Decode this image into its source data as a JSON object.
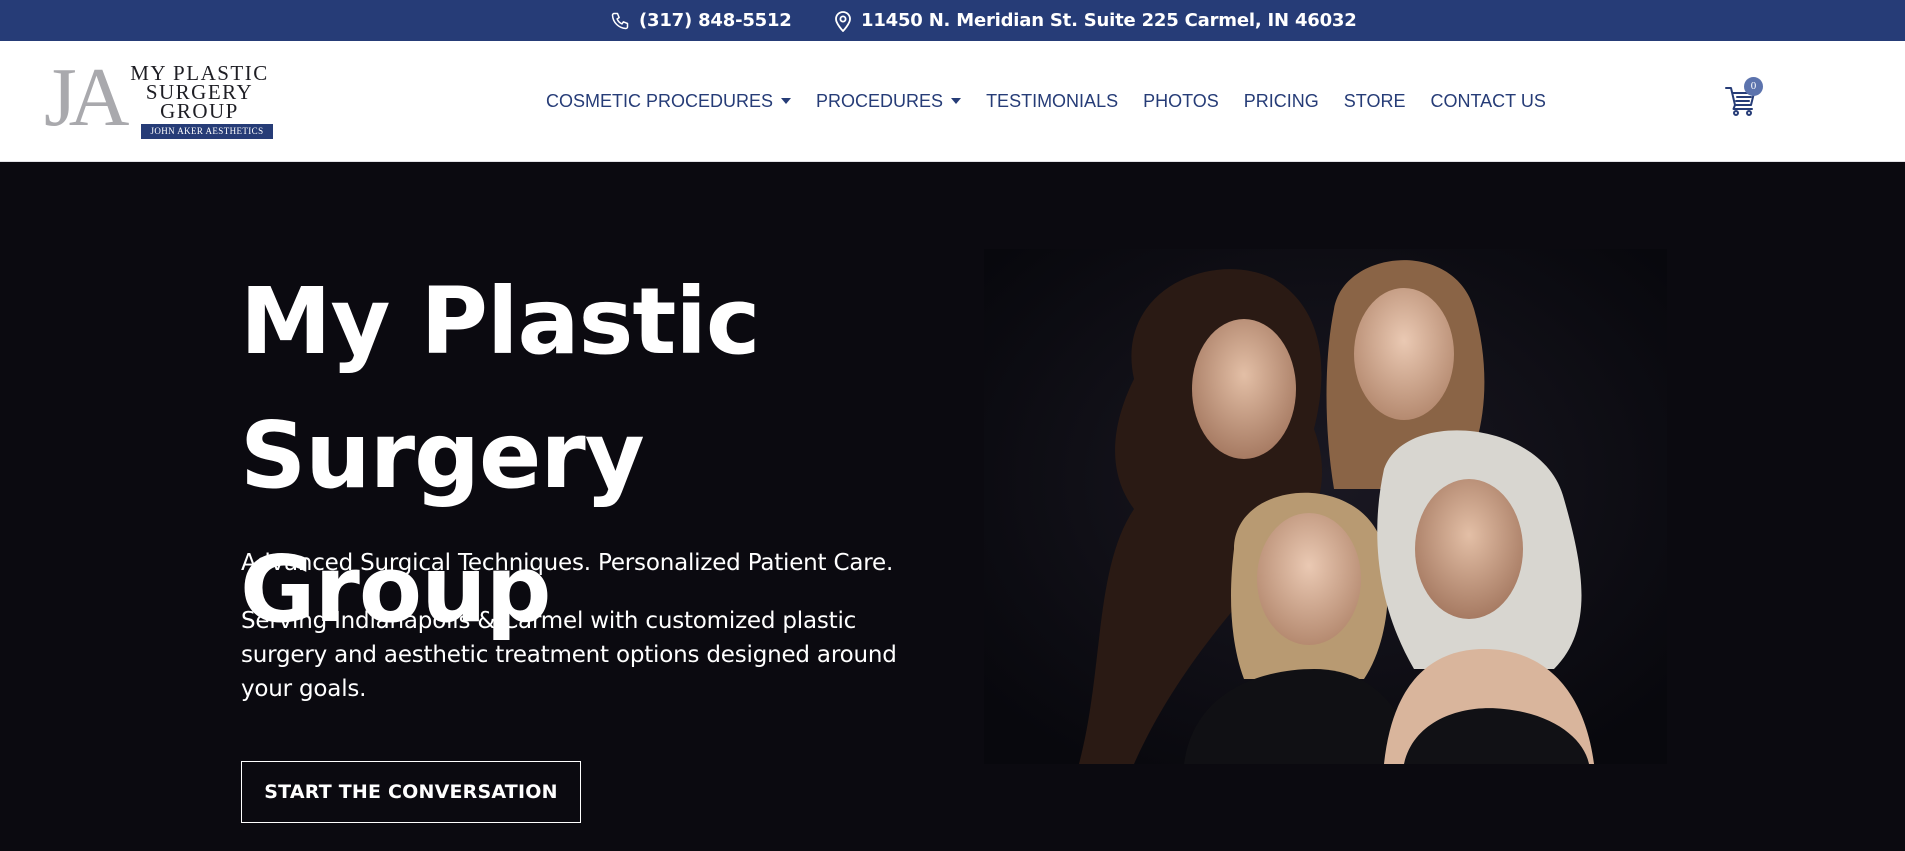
{
  "topbar": {
    "phone": "(317) 848-5512",
    "phone_icon": "phone-icon",
    "address": "11450 N. Meridian St. Suite 225 Carmel, IN 46032",
    "address_icon": "map-pin-icon"
  },
  "logo": {
    "monogram": "JA",
    "line1": "MY PLASTIC",
    "line2": "SURGERY",
    "line3": "GROUP",
    "tagline": "JOHN AKER AESTHETICS"
  },
  "nav": {
    "items": [
      {
        "label": "COSMETIC PROCEDURES",
        "dropdown": true
      },
      {
        "label": "PROCEDURES",
        "dropdown": true
      },
      {
        "label": "TESTIMONIALS",
        "dropdown": false
      },
      {
        "label": "PHOTOS",
        "dropdown": false
      },
      {
        "label": "PRICING",
        "dropdown": false
      },
      {
        "label": "STORE",
        "dropdown": false
      },
      {
        "label": "CONTACT US",
        "dropdown": false
      }
    ]
  },
  "cart": {
    "icon": "cart-icon",
    "count": "0"
  },
  "hero": {
    "title_line1": "My Plastic",
    "title_line2": "Surgery Group",
    "lead": "Advanced Surgical Techniques. Personalized Patient Care.",
    "desc_line1": "Serving Indianapolis & Carmel with customized plastic",
    "desc_line2": "surgery and aesthetic treatment options designed around",
    "desc_line3": "your goals.",
    "cta": "START THE CONVERSATION"
  },
  "colors": {
    "brand_navy": "#263c77",
    "hero_bg": "#0b0a10",
    "badge": "#5c73ad"
  }
}
